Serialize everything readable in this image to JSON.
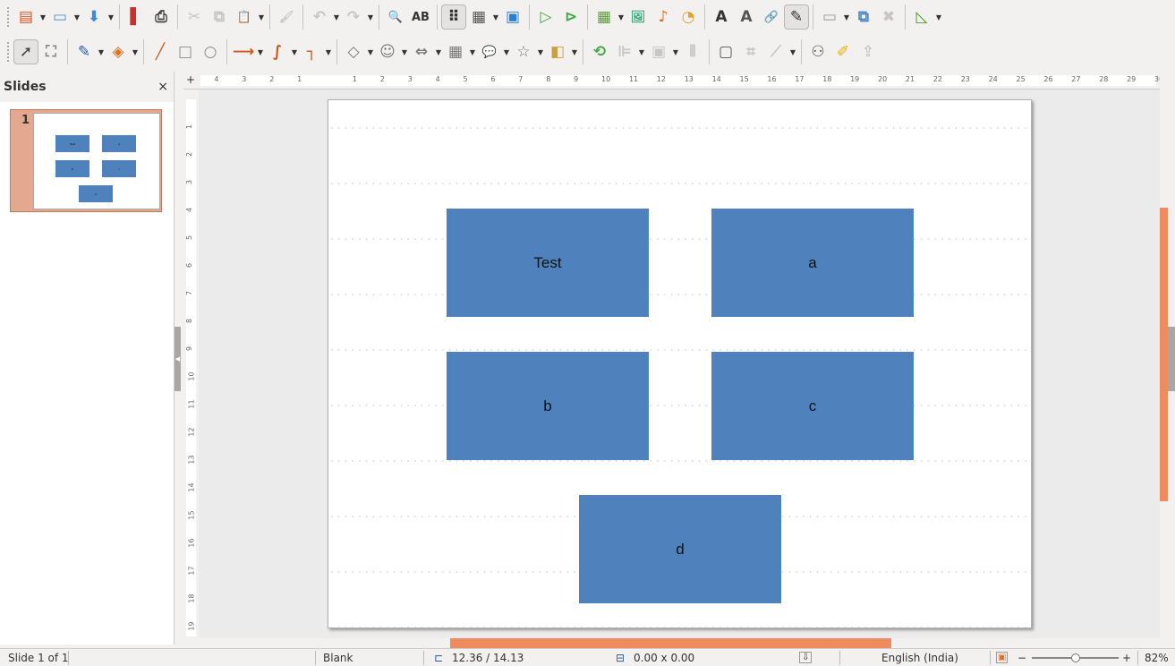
{
  "toolbar1": [
    {
      "n": "new-presentation",
      "g": "▤",
      "c": "#d9531e",
      "dd": 1
    },
    {
      "n": "open",
      "g": "▭",
      "c": "#5a8fc8",
      "dd": 1
    },
    {
      "n": "save",
      "g": "⬇",
      "c": "#3d8ad6",
      "dd": 1
    },
    {
      "sep": 1
    },
    {
      "n": "export-pdf",
      "g": "▌",
      "c": "#c9302c"
    },
    {
      "n": "print",
      "g": "⎙",
      "c": "#444"
    },
    {
      "sep": 1
    },
    {
      "n": "cut",
      "g": "✂",
      "dis": 1
    },
    {
      "n": "copy",
      "g": "⧉",
      "dis": 1
    },
    {
      "n": "paste",
      "g": "📋",
      "c": "#8a6d3b",
      "dd": 1
    },
    {
      "sep": 1
    },
    {
      "n": "clone-formatting",
      "g": "🖌",
      "dis": 1
    },
    {
      "sep": 1
    },
    {
      "n": "undo",
      "g": "↶",
      "dis": 1,
      "dd": 1
    },
    {
      "n": "redo",
      "g": "↷",
      "dis": 1,
      "dd": 1
    },
    {
      "sep": 1
    },
    {
      "n": "find-replace",
      "g": "🔍",
      "c": "#333"
    },
    {
      "n": "spelling",
      "g": "AB",
      "c": "#333"
    },
    {
      "sep": 1
    },
    {
      "n": "display-grid",
      "g": "⠿",
      "c": "#333",
      "active": 1
    },
    {
      "n": "display-views",
      "g": "▦",
      "c": "#555",
      "dd": 1
    },
    {
      "n": "master-slide",
      "g": "▣",
      "c": "#2a7fd0"
    },
    {
      "sep": 1
    },
    {
      "n": "start-first-slide",
      "g": "▷",
      "c": "#4a4"
    },
    {
      "n": "start-current-slide",
      "g": "⊳",
      "c": "#4a4"
    },
    {
      "sep": 1
    },
    {
      "n": "table",
      "g": "▦",
      "c": "#5a9a3a",
      "dd": 1
    },
    {
      "n": "image",
      "g": "🖼",
      "c": "#3a7"
    },
    {
      "n": "media",
      "g": "♪",
      "c": "#e8661e"
    },
    {
      "n": "chart",
      "g": "◔",
      "c": "#e8a030"
    },
    {
      "sep": 1
    },
    {
      "n": "text-box",
      "g": "A",
      "c": "#333"
    },
    {
      "n": "fontwork",
      "g": "A",
      "c": "#555"
    },
    {
      "n": "hyperlink",
      "g": "🔗",
      "c": "#777"
    },
    {
      "n": "draw-functions",
      "g": "✎",
      "c": "#333",
      "active": 1
    },
    {
      "sep": 1
    },
    {
      "n": "slide",
      "g": "▭",
      "c": "#999",
      "dd": 1
    },
    {
      "n": "duplicate-slide",
      "g": "⧉",
      "c": "#4a88c8"
    },
    {
      "n": "delete-slide",
      "g": "✖",
      "dis": 1
    },
    {
      "sep": 1
    },
    {
      "n": "slide-layout",
      "g": "◺",
      "c": "#4a9a2a",
      "dd": 1
    }
  ],
  "toolbar2": [
    {
      "n": "select",
      "g": "➚",
      "c": "#444",
      "active": 1
    },
    {
      "n": "zoom-pan",
      "g": "⛶",
      "c": "#888"
    },
    {
      "sep": 1
    },
    {
      "n": "line-color",
      "g": "✎",
      "c": "#2b5fa5",
      "dd": 1
    },
    {
      "n": "fill-color",
      "g": "◈",
      "c": "#e07020",
      "dd": 1
    },
    {
      "sep": 1
    },
    {
      "n": "line",
      "g": "╱",
      "c": "#d0561b"
    },
    {
      "n": "rectangle",
      "g": "□",
      "c": "#888"
    },
    {
      "n": "ellipse",
      "g": "○",
      "c": "#888"
    },
    {
      "sep": 1
    },
    {
      "n": "lines-arrows",
      "g": "⟶",
      "c": "#d0561b",
      "dd": 1
    },
    {
      "n": "curves",
      "g": "∫",
      "c": "#d0561b",
      "dd": 1
    },
    {
      "n": "connectors",
      "g": "┐",
      "c": "#d0561b",
      "dd": 1
    },
    {
      "sep": 1
    },
    {
      "n": "basic-shapes",
      "g": "◇",
      "c": "#777",
      "dd": 1
    },
    {
      "n": "symbol-shapes",
      "g": "☺",
      "c": "#777",
      "dd": 1
    },
    {
      "n": "block-arrows",
      "g": "⇔",
      "c": "#777",
      "dd": 1
    },
    {
      "n": "flowchart",
      "g": "▦",
      "c": "#777",
      "dd": 1
    },
    {
      "n": "callouts",
      "g": "💬",
      "c": "#777",
      "dd": 1
    },
    {
      "n": "stars",
      "g": "☆",
      "c": "#777",
      "dd": 1
    },
    {
      "n": "3d-objects",
      "g": "◧",
      "c": "#c9a040",
      "dd": 1
    },
    {
      "sep": 1
    },
    {
      "n": "rotate",
      "g": "⟲",
      "c": "#4a4"
    },
    {
      "n": "align",
      "g": "⊫",
      "dis": 1,
      "dd": 1
    },
    {
      "n": "arrange",
      "g": "▣",
      "dis": 1,
      "dd": 1
    },
    {
      "n": "distribute",
      "g": "⫴",
      "dis": 1
    },
    {
      "sep": 1
    },
    {
      "n": "shadow",
      "g": "▢",
      "c": "#555"
    },
    {
      "n": "crop",
      "g": "⌗",
      "dis": 1
    },
    {
      "n": "filter",
      "g": "⟋",
      "dis": 1,
      "dd": 1
    },
    {
      "sep": 1
    },
    {
      "n": "glue-points",
      "g": "⚇",
      "c": "#555"
    },
    {
      "n": "points",
      "g": "✐",
      "c": "#e0b000"
    },
    {
      "n": "extrusion",
      "g": "⇪",
      "dis": 1
    }
  ],
  "panel": {
    "title": "Slides",
    "close": "×",
    "slide_number": "1"
  },
  "slide": {
    "shapes": [
      {
        "label": "Test"
      },
      {
        "label": "a"
      },
      {
        "label": "b"
      },
      {
        "label": "c"
      },
      {
        "label": "d"
      }
    ],
    "fill": "#4f81bd"
  },
  "ruler": {
    "h": [
      "4",
      "3",
      "2",
      "1",
      "1",
      "2",
      "3",
      "4",
      "5",
      "6",
      "7",
      "8",
      "9",
      "10",
      "11",
      "12",
      "13",
      "14",
      "15",
      "16",
      "17",
      "18",
      "19",
      "20",
      "21",
      "22",
      "23",
      "24",
      "25",
      "26",
      "27",
      "28",
      "29",
      "30"
    ],
    "v": [
      "1",
      "2",
      "3",
      "4",
      "5",
      "6",
      "7",
      "8",
      "9",
      "10",
      "11",
      "12",
      "13",
      "14",
      "15",
      "16",
      "17",
      "18",
      "19"
    ]
  },
  "status": {
    "slide": "Slide 1 of 1",
    "layout": "Blank",
    "position": "12.36 / 14.13",
    "size": "0.00 x 0.00",
    "language": "English (India)",
    "zoom_minus": "−",
    "zoom_plus": "+",
    "zoom": "82%",
    "zoom_fraction": 0.5
  }
}
